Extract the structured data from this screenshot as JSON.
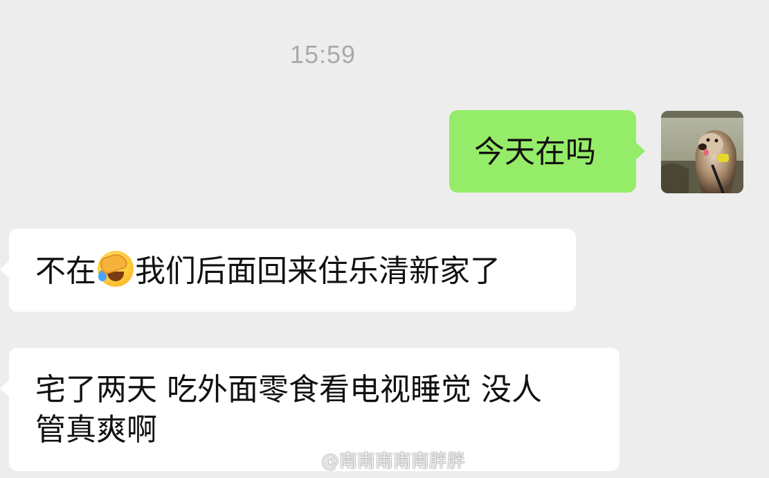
{
  "chat": {
    "timestamp": "15:59",
    "messages": [
      {
        "direction": "outgoing",
        "text": "今天在吗"
      },
      {
        "direction": "incoming",
        "text_before_emoji": "不在",
        "emoji": "face-palm-crying-emoji",
        "text_after_emoji": "我们后面回来住乐清新家了"
      },
      {
        "direction": "incoming",
        "lines": [
          "宅了两天 吃外面零食看电视睡觉 没人",
          "管真爽啊"
        ]
      }
    ],
    "avatar": {
      "description": "dog photo avatar"
    }
  },
  "watermark": {
    "icon": "weibo-logo-icon",
    "text": "@南南南南南胖胖"
  },
  "colors": {
    "background": "#ededed",
    "outgoing_bubble": "#95ec69",
    "incoming_bubble": "#ffffff",
    "timestamp": "#a9a9a9"
  }
}
